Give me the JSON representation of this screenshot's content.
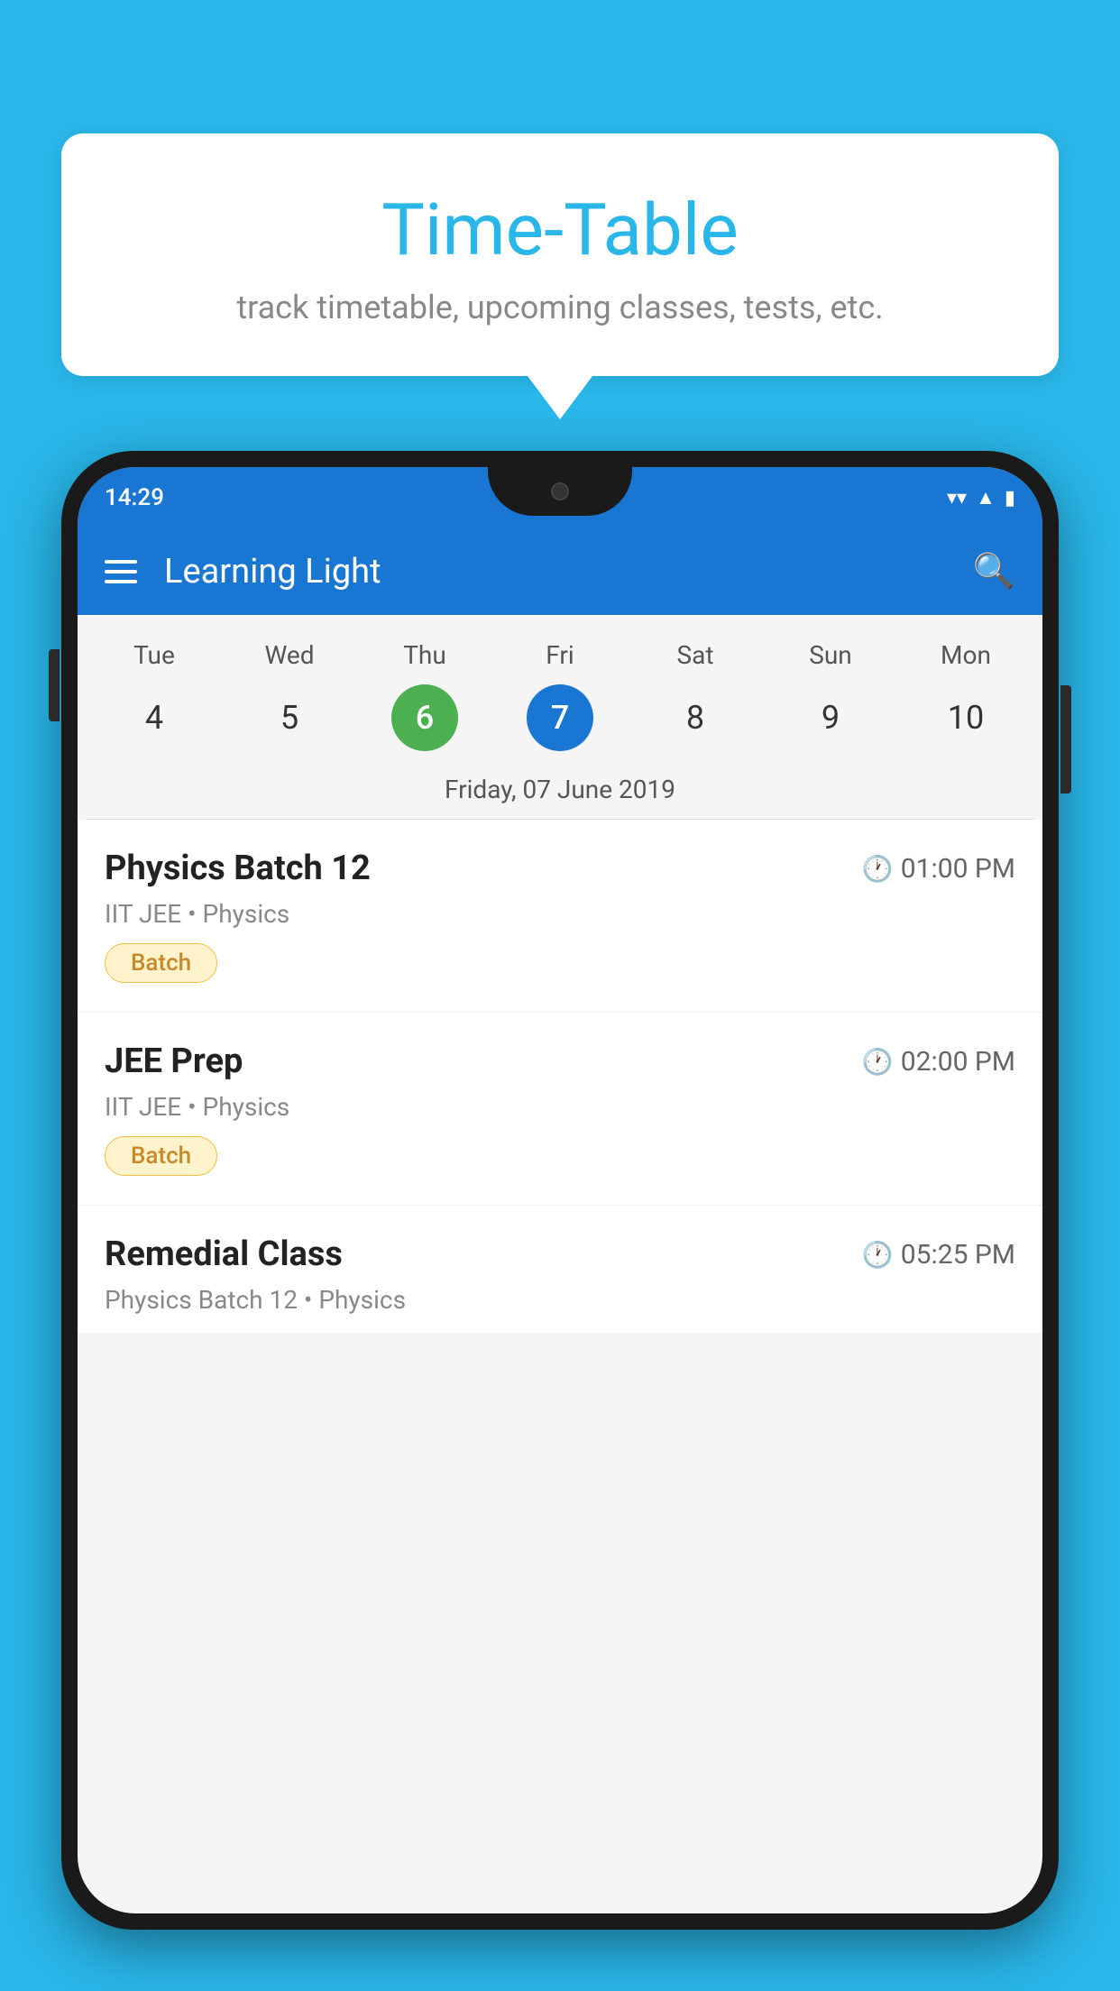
{
  "background_color": "#29b6e8",
  "speech_bubble": {
    "title": "Time-Table",
    "subtitle": "track timetable, upcoming classes, tests, etc."
  },
  "phone": {
    "status_bar": {
      "time": "14:29"
    },
    "app_bar": {
      "title": "Learning Light"
    },
    "calendar": {
      "days": [
        {
          "label": "Tue",
          "num": "4"
        },
        {
          "label": "Wed",
          "num": "5"
        },
        {
          "label": "Thu",
          "num": "6",
          "state": "today"
        },
        {
          "label": "Fri",
          "num": "7",
          "state": "selected"
        },
        {
          "label": "Sat",
          "num": "8"
        },
        {
          "label": "Sun",
          "num": "9"
        },
        {
          "label": "Mon",
          "num": "10"
        }
      ],
      "selected_date": "Friday, 07 June 2019"
    },
    "schedule": [
      {
        "title": "Physics Batch 12",
        "time": "01:00 PM",
        "subtitle": "IIT JEE • Physics",
        "tag": "Batch"
      },
      {
        "title": "JEE Prep",
        "time": "02:00 PM",
        "subtitle": "IIT JEE • Physics",
        "tag": "Batch"
      },
      {
        "title": "Remedial Class",
        "time": "05:25 PM",
        "subtitle": "Physics Batch 12 • Physics",
        "tag": null,
        "partial": true
      }
    ]
  }
}
